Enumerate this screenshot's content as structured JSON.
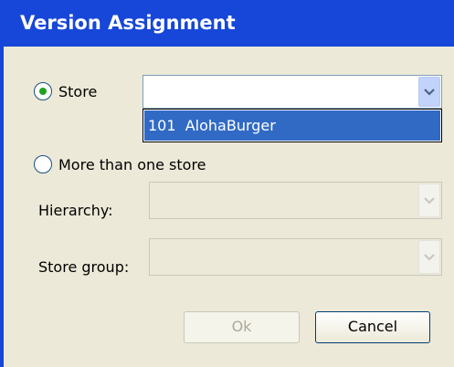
{
  "dialog": {
    "title": "Version Assignment"
  },
  "options": {
    "store_label": "Store",
    "store_selected": true,
    "multi_label": "More than one store",
    "multi_selected": false
  },
  "store_combo": {
    "value": ""
  },
  "dropdown": {
    "items": [
      "101  AlohaBurger"
    ],
    "highlighted_index": 0
  },
  "fields": {
    "hierarchy_label": "Hierarchy:",
    "store_group_label": "Store group:"
  },
  "buttons": {
    "ok_label": "Ok",
    "cancel_label": "Cancel"
  },
  "colors": {
    "title_bar": "#1747d8",
    "client_bg": "#ece9d8",
    "selection": "#316ac5",
    "radio_dot": "#21a121"
  },
  "icons": {
    "combo_arrow": "chevron-down-icon"
  }
}
